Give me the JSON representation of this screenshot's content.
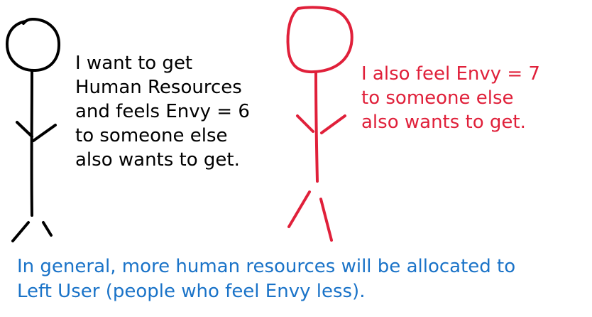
{
  "colors": {
    "left_figure": "#000000",
    "right_figure": "#e0203a",
    "summary_text": "#1a73c8"
  },
  "left_user": {
    "speech": "I want to get\nHuman Resources\nand feels Envy = 6\nto someone else\nalso wants to get."
  },
  "right_user": {
    "speech": "I also feel Envy = 7\nto someone else\nalso wants to get."
  },
  "summary": "In general, more human resources will be allocated to\nLeft User (people who feel Envy less)."
}
